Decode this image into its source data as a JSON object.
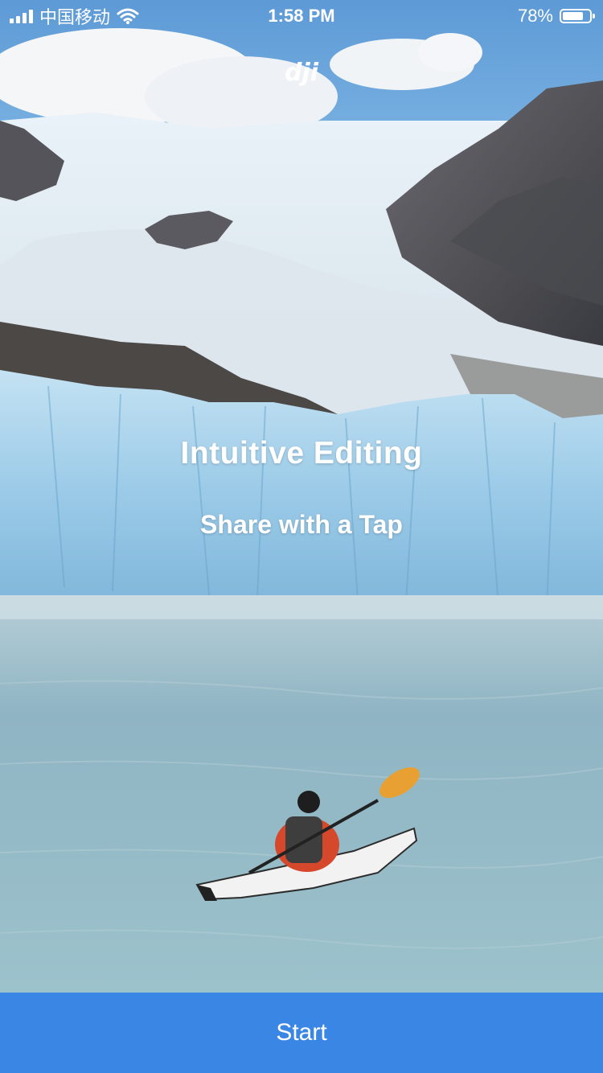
{
  "status_bar": {
    "carrier": "中国移动",
    "time": "1:58 PM",
    "battery_percent_label": "78%",
    "battery_level": 0.78,
    "signal_bars": 4,
    "icons": [
      "signal-icon",
      "wifi-icon",
      "battery-icon"
    ]
  },
  "brand": {
    "logo_text": "dji",
    "logo_icon": "dji-logo-icon"
  },
  "onboarding": {
    "headline": "Intuitive Editing",
    "subhead": "Share with a Tap",
    "background_scene": "glacier-kayak-photo"
  },
  "footer": {
    "start_label": "Start"
  },
  "colors": {
    "accent": "#3a86e5",
    "text": "#ffffff",
    "sky": "#6ea8dc",
    "ice": "#a8d4ec",
    "water": "#8fb6c4"
  }
}
